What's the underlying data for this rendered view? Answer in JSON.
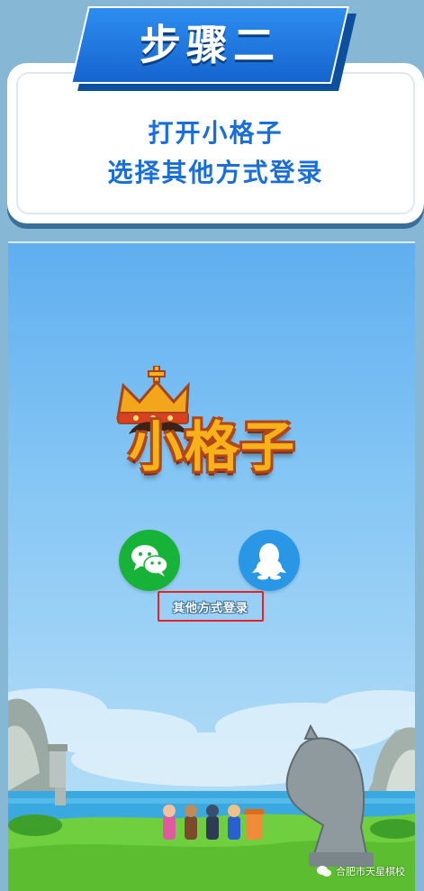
{
  "header": {
    "step_title": "步骤二",
    "instruction_line1": "打开小格子",
    "instruction_line2": "选择其他方式登录"
  },
  "app": {
    "logo_text": "小格子",
    "login_options": [
      {
        "name": "wechat",
        "icon": "wechat-icon",
        "color": "#17b338"
      },
      {
        "name": "qq",
        "icon": "qq-penguin-icon",
        "color": "#2a97e6"
      }
    ],
    "other_login_label": "其他方式登录",
    "highlight_color": "#e82222"
  },
  "watermark": {
    "icon": "wechat-official-account-icon",
    "text": "合肥市天星棋校"
  },
  "colors": {
    "accent_blue": "#1a6ed8",
    "banner_blue": "#1565cf",
    "page_background": "#86b8d6"
  }
}
